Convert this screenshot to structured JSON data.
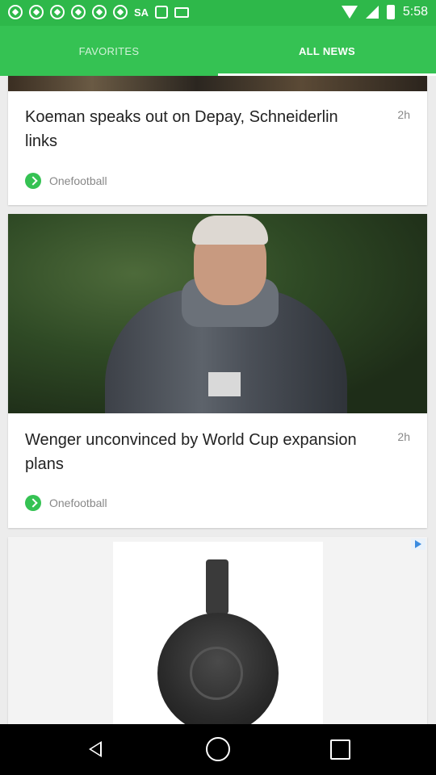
{
  "status_bar": {
    "time": "5:58",
    "carrier_label": "SA",
    "icons": [
      "soccer-ball-icon",
      "soccer-ball-icon",
      "soccer-ball-icon",
      "soccer-ball-icon",
      "soccer-ball-icon",
      "soccer-ball-icon",
      "sa-icon",
      "edit-icon",
      "mail-icon",
      "wifi-icon",
      "signal-icon",
      "battery-icon"
    ]
  },
  "tabs": {
    "favorites_label": "FAVORITES",
    "all_news_label": "ALL NEWS",
    "active_tab": "ALL NEWS",
    "accent_color": "#35c253"
  },
  "articles": [
    {
      "headline": "Koeman speaks out on Depay, Schneiderlin links",
      "age": "2h",
      "source": "Onefootball"
    },
    {
      "headline": "Wenger unconvinced by World Cup expansion plans",
      "age": "2h",
      "source": "Onefootball"
    }
  ],
  "ad": {
    "badge_icon": "adchoices-icon"
  },
  "nav_bar": {
    "icons": [
      "back-icon",
      "home-icon",
      "recents-icon"
    ]
  }
}
